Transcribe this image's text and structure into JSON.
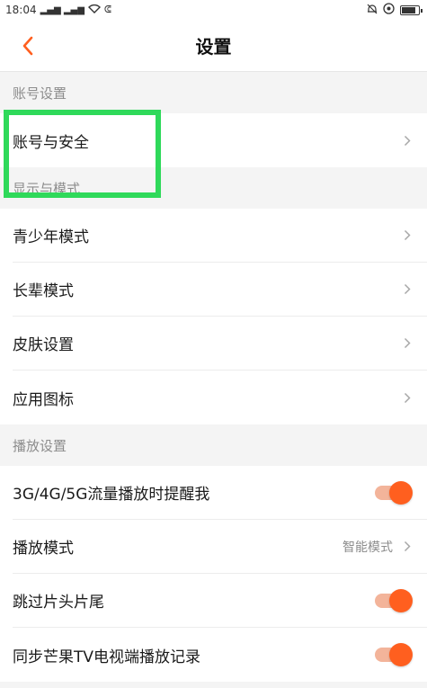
{
  "status": {
    "time": "18:04",
    "signal": "⁴ᴳıl ⁴ᴳıl",
    "extra": "ጸ",
    "alarm": "🔔",
    "vpn": "ⓐ"
  },
  "header": {
    "title": "设置"
  },
  "sections": {
    "account": {
      "title": "账号设置",
      "items": [
        {
          "label": "账号与安全"
        }
      ]
    },
    "display": {
      "title": "显示与模式",
      "items": [
        {
          "label": "青少年模式"
        },
        {
          "label": "长辈模式"
        },
        {
          "label": "皮肤设置"
        },
        {
          "label": "应用图标"
        }
      ]
    },
    "playback": {
      "title": "播放设置",
      "items": [
        {
          "label": "3G/4G/5G流量播放时提醒我",
          "toggle": true
        },
        {
          "label": "播放模式",
          "value": "智能模式"
        },
        {
          "label": "跳过片头片尾",
          "toggle": true
        },
        {
          "label": "同步芒果TV电视端播放记录",
          "toggle": true
        }
      ]
    }
  },
  "colors": {
    "accent": "#ff5f1f",
    "highlight": "#2fd95a"
  }
}
